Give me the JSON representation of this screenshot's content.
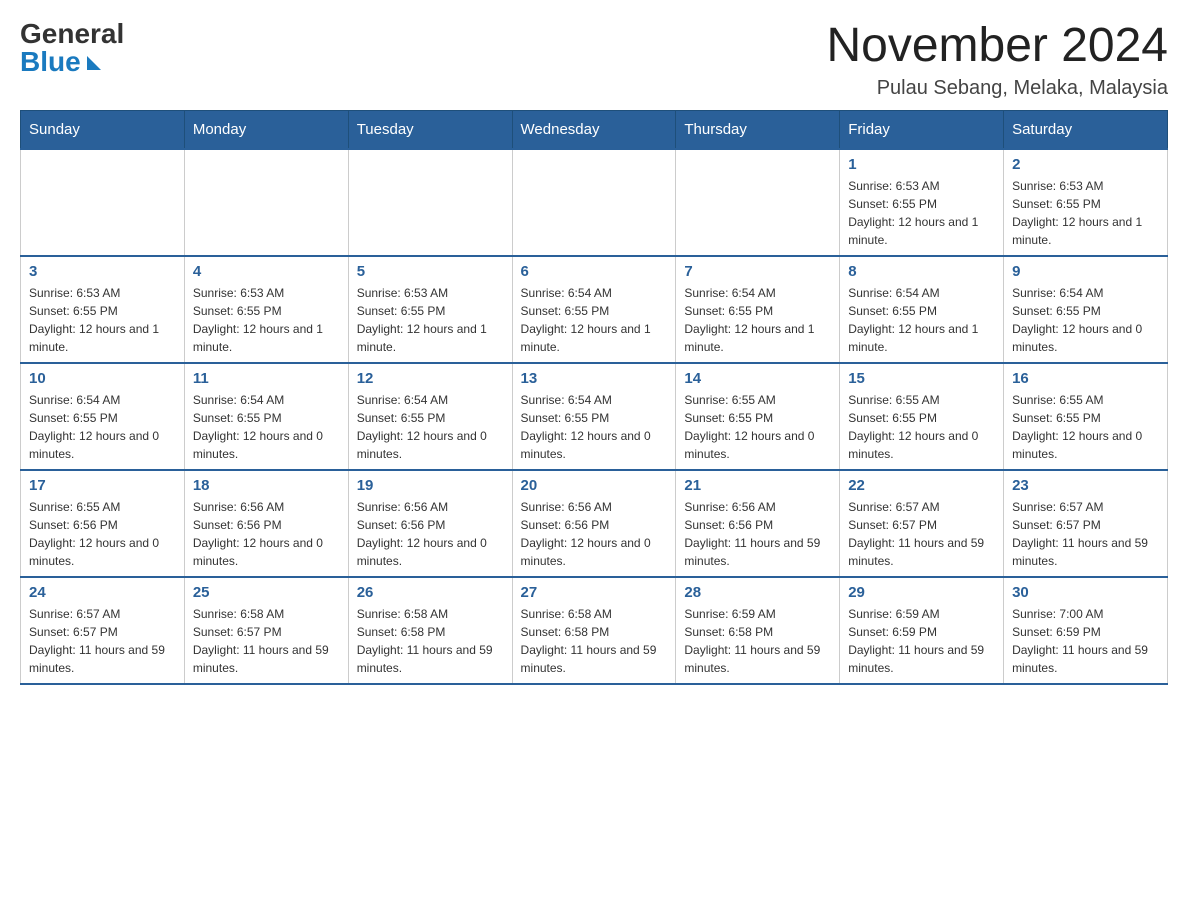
{
  "logo": {
    "general": "General",
    "blue": "Blue"
  },
  "title": {
    "month_year": "November 2024",
    "location": "Pulau Sebang, Melaka, Malaysia"
  },
  "weekdays": [
    "Sunday",
    "Monday",
    "Tuesday",
    "Wednesday",
    "Thursday",
    "Friday",
    "Saturday"
  ],
  "weeks": [
    [
      {
        "day": "",
        "info": ""
      },
      {
        "day": "",
        "info": ""
      },
      {
        "day": "",
        "info": ""
      },
      {
        "day": "",
        "info": ""
      },
      {
        "day": "",
        "info": ""
      },
      {
        "day": "1",
        "info": "Sunrise: 6:53 AM\nSunset: 6:55 PM\nDaylight: 12 hours and 1 minute."
      },
      {
        "day": "2",
        "info": "Sunrise: 6:53 AM\nSunset: 6:55 PM\nDaylight: 12 hours and 1 minute."
      }
    ],
    [
      {
        "day": "3",
        "info": "Sunrise: 6:53 AM\nSunset: 6:55 PM\nDaylight: 12 hours and 1 minute."
      },
      {
        "day": "4",
        "info": "Sunrise: 6:53 AM\nSunset: 6:55 PM\nDaylight: 12 hours and 1 minute."
      },
      {
        "day": "5",
        "info": "Sunrise: 6:53 AM\nSunset: 6:55 PM\nDaylight: 12 hours and 1 minute."
      },
      {
        "day": "6",
        "info": "Sunrise: 6:54 AM\nSunset: 6:55 PM\nDaylight: 12 hours and 1 minute."
      },
      {
        "day": "7",
        "info": "Sunrise: 6:54 AM\nSunset: 6:55 PM\nDaylight: 12 hours and 1 minute."
      },
      {
        "day": "8",
        "info": "Sunrise: 6:54 AM\nSunset: 6:55 PM\nDaylight: 12 hours and 1 minute."
      },
      {
        "day": "9",
        "info": "Sunrise: 6:54 AM\nSunset: 6:55 PM\nDaylight: 12 hours and 0 minutes."
      }
    ],
    [
      {
        "day": "10",
        "info": "Sunrise: 6:54 AM\nSunset: 6:55 PM\nDaylight: 12 hours and 0 minutes."
      },
      {
        "day": "11",
        "info": "Sunrise: 6:54 AM\nSunset: 6:55 PM\nDaylight: 12 hours and 0 minutes."
      },
      {
        "day": "12",
        "info": "Sunrise: 6:54 AM\nSunset: 6:55 PM\nDaylight: 12 hours and 0 minutes."
      },
      {
        "day": "13",
        "info": "Sunrise: 6:54 AM\nSunset: 6:55 PM\nDaylight: 12 hours and 0 minutes."
      },
      {
        "day": "14",
        "info": "Sunrise: 6:55 AM\nSunset: 6:55 PM\nDaylight: 12 hours and 0 minutes."
      },
      {
        "day": "15",
        "info": "Sunrise: 6:55 AM\nSunset: 6:55 PM\nDaylight: 12 hours and 0 minutes."
      },
      {
        "day": "16",
        "info": "Sunrise: 6:55 AM\nSunset: 6:55 PM\nDaylight: 12 hours and 0 minutes."
      }
    ],
    [
      {
        "day": "17",
        "info": "Sunrise: 6:55 AM\nSunset: 6:56 PM\nDaylight: 12 hours and 0 minutes."
      },
      {
        "day": "18",
        "info": "Sunrise: 6:56 AM\nSunset: 6:56 PM\nDaylight: 12 hours and 0 minutes."
      },
      {
        "day": "19",
        "info": "Sunrise: 6:56 AM\nSunset: 6:56 PM\nDaylight: 12 hours and 0 minutes."
      },
      {
        "day": "20",
        "info": "Sunrise: 6:56 AM\nSunset: 6:56 PM\nDaylight: 12 hours and 0 minutes."
      },
      {
        "day": "21",
        "info": "Sunrise: 6:56 AM\nSunset: 6:56 PM\nDaylight: 11 hours and 59 minutes."
      },
      {
        "day": "22",
        "info": "Sunrise: 6:57 AM\nSunset: 6:57 PM\nDaylight: 11 hours and 59 minutes."
      },
      {
        "day": "23",
        "info": "Sunrise: 6:57 AM\nSunset: 6:57 PM\nDaylight: 11 hours and 59 minutes."
      }
    ],
    [
      {
        "day": "24",
        "info": "Sunrise: 6:57 AM\nSunset: 6:57 PM\nDaylight: 11 hours and 59 minutes."
      },
      {
        "day": "25",
        "info": "Sunrise: 6:58 AM\nSunset: 6:57 PM\nDaylight: 11 hours and 59 minutes."
      },
      {
        "day": "26",
        "info": "Sunrise: 6:58 AM\nSunset: 6:58 PM\nDaylight: 11 hours and 59 minutes."
      },
      {
        "day": "27",
        "info": "Sunrise: 6:58 AM\nSunset: 6:58 PM\nDaylight: 11 hours and 59 minutes."
      },
      {
        "day": "28",
        "info": "Sunrise: 6:59 AM\nSunset: 6:58 PM\nDaylight: 11 hours and 59 minutes."
      },
      {
        "day": "29",
        "info": "Sunrise: 6:59 AM\nSunset: 6:59 PM\nDaylight: 11 hours and 59 minutes."
      },
      {
        "day": "30",
        "info": "Sunrise: 7:00 AM\nSunset: 6:59 PM\nDaylight: 11 hours and 59 minutes."
      }
    ]
  ]
}
